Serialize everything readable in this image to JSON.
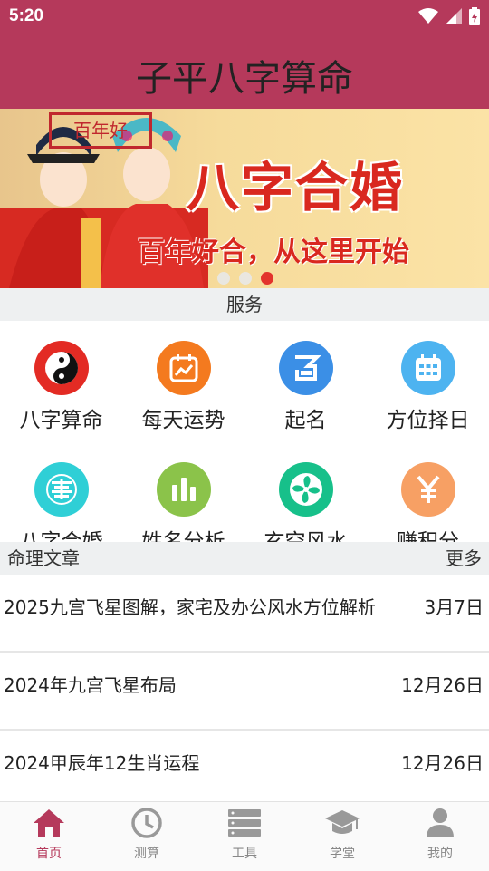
{
  "status_bar": {
    "time": "5:20"
  },
  "app_bar": {
    "title": "子平八字算命"
  },
  "banner": {
    "stamp_text": "百年好",
    "headline": "八字合婚",
    "tagline": "百年好合，从这里开始",
    "carousel_pages": 3,
    "active_page": 3
  },
  "services": {
    "header": "服务",
    "items": [
      {
        "label": "八字算命",
        "icon": "yin-yang-icon",
        "color": "#e32b24"
      },
      {
        "label": "每天运势",
        "icon": "calendar-chart-icon",
        "color": "#f47a1f"
      },
      {
        "label": "起名",
        "icon": "name-icon",
        "color": "#3b8fe6"
      },
      {
        "label": "方位择日",
        "icon": "calendar-grid-icon",
        "color": "#4db3f0"
      },
      {
        "label": "八字合婚",
        "icon": "double-happiness-icon",
        "color": "#2fcfd6"
      },
      {
        "label": "姓名分析",
        "icon": "bar-chart-icon",
        "color": "#8bc34a"
      },
      {
        "label": "玄空风水",
        "icon": "fan-icon",
        "color": "#17c08a"
      },
      {
        "label": "赚积分",
        "icon": "yen-icon",
        "color": "#f7a064"
      }
    ]
  },
  "articles": {
    "header": "命理文章",
    "more": "更多",
    "items": [
      {
        "title": "2025九宫飞星图解，家宅及办公风水方位解析",
        "date": "3月7日"
      },
      {
        "title": "2024年九宫飞星布局",
        "date": "12月26日"
      },
      {
        "title": "2024甲辰年12生肖运程",
        "date": "12月26日"
      }
    ]
  },
  "tab_bar": {
    "items": [
      {
        "label": "首页",
        "icon": "home-icon",
        "active": true
      },
      {
        "label": "测算",
        "icon": "clock-icon",
        "active": false
      },
      {
        "label": "工具",
        "icon": "server-stack-icon",
        "active": false
      },
      {
        "label": "学堂",
        "icon": "graduation-cap-icon",
        "active": false
      },
      {
        "label": "我的",
        "icon": "person-icon",
        "active": false
      }
    ],
    "active_color": "#b5395b"
  }
}
